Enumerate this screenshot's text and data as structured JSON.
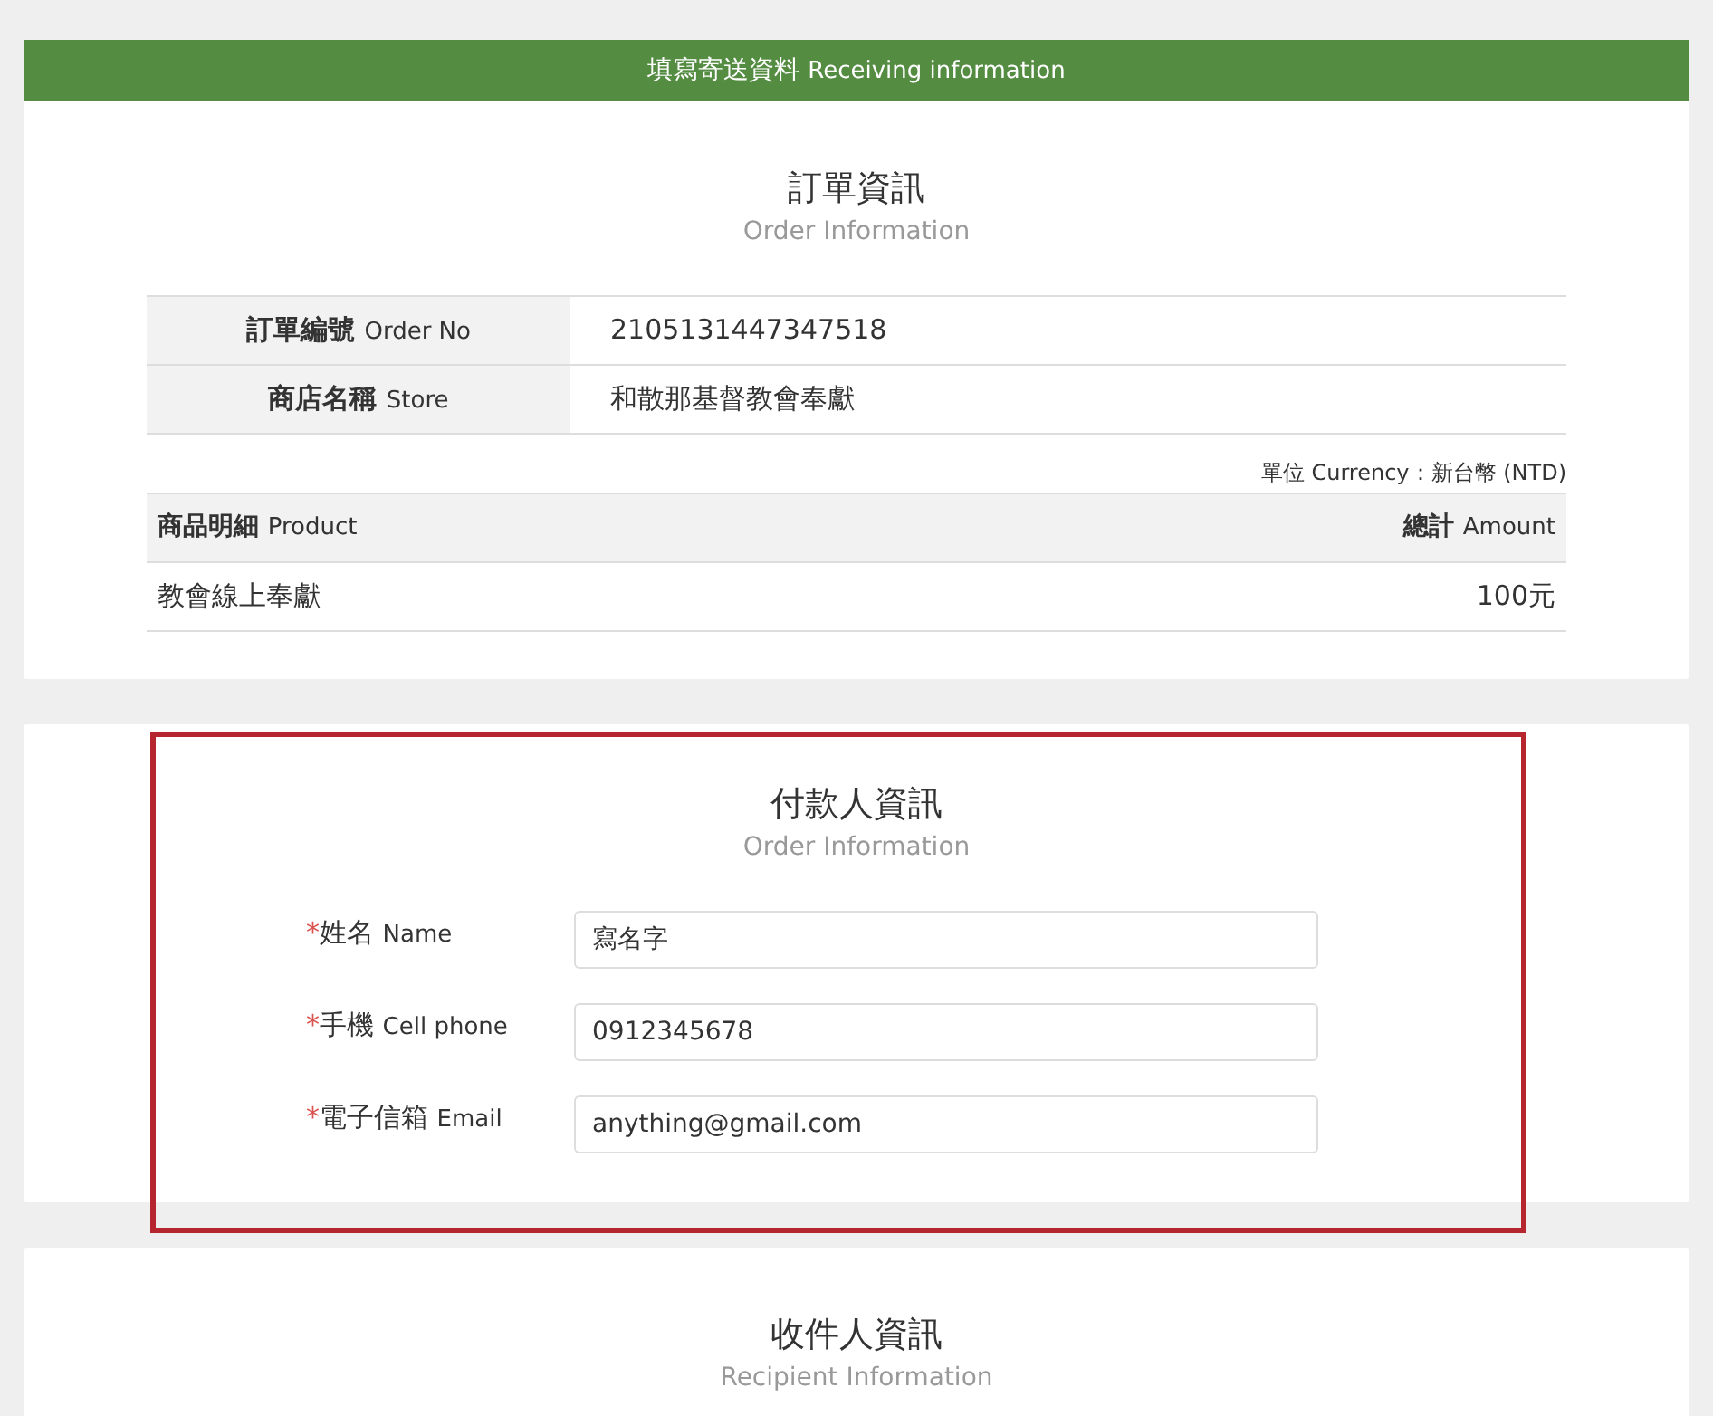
{
  "header": {
    "title": "填寫寄送資料",
    "subtitle": "Receiving information"
  },
  "order": {
    "title": "訂單資訊",
    "subtitle": "Order Information",
    "details": [
      {
        "label": "訂單編號",
        "label_en": "Order No",
        "value": "2105131447347518"
      },
      {
        "label": "商店名稱",
        "label_en": "Store",
        "value": "和散那基督教會奉獻"
      }
    ],
    "currency": "單位 Currency：新台幣 (NTD)",
    "columns": [
      {
        "label": "商品明細",
        "label_en": "Product"
      },
      {
        "label": "總計",
        "label_en": "Amount"
      }
    ],
    "rows": [
      {
        "product": "教會線上奉獻",
        "amount": "100元"
      }
    ]
  },
  "payer": {
    "title": "付款人資訊",
    "subtitle": "Order Information",
    "highlighted": true,
    "fields": [
      {
        "mark": "*",
        "label": "姓名",
        "label_en": "Name",
        "value": "寫名字"
      },
      {
        "mark": "*",
        "label": "手機",
        "label_en": "Cell phone",
        "value": "0912345678"
      },
      {
        "mark": "*",
        "label": "電子信箱",
        "label_en": "Email",
        "value": "anything@gmail.com"
      }
    ]
  },
  "recipient": {
    "title": "收件人資訊",
    "subtitle": "Recipient Information"
  }
}
